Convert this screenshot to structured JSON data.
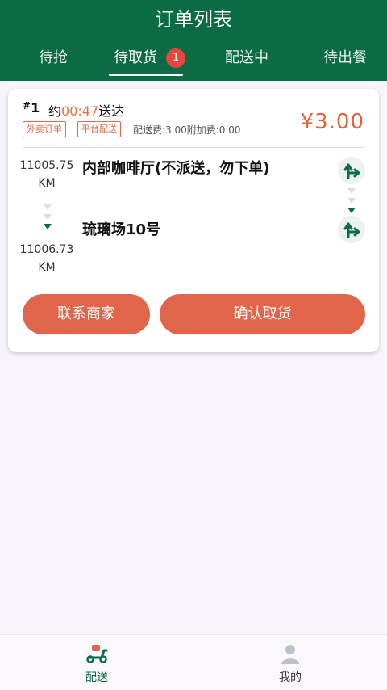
{
  "header": {
    "title": "订单列表"
  },
  "tabs": [
    {
      "label": "待抢"
    },
    {
      "label": "待取货",
      "badge": "1"
    },
    {
      "label": "配送中"
    },
    {
      "label": "待出餐"
    }
  ],
  "order": {
    "number_prefix": "#",
    "number": "1",
    "eta_prefix": "约",
    "eta_time": "00:47",
    "eta_suffix": "送达",
    "tags": [
      "外卖订单",
      "平台配送"
    ],
    "fees": "配送费:3.00附加费:0.00",
    "price": "¥3.00",
    "pickup": {
      "distance": "11005.75",
      "unit": "KM",
      "address": "内部咖啡厅(不派送，勿下单)"
    },
    "dropoff": {
      "distance": "11006.73",
      "unit": "KM",
      "address": "琉璃场10号"
    },
    "buttons": {
      "contact": "联系商家",
      "confirm": "确认取货"
    }
  },
  "bottom_nav": [
    {
      "label": "配送",
      "icon": "scooter-icon",
      "active": true
    },
    {
      "label": "我的",
      "icon": "user-icon",
      "active": false
    }
  ],
  "colors": {
    "brand_green": "#0a6b45",
    "accent_orange": "#e0654a",
    "badge_red": "#e5473f"
  }
}
